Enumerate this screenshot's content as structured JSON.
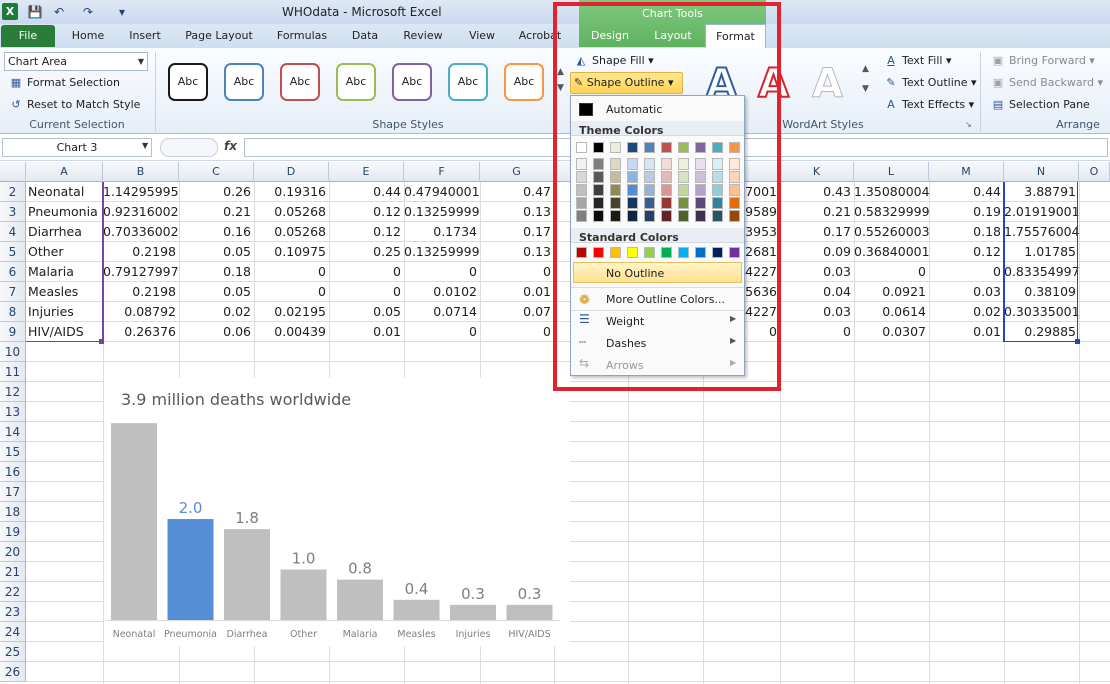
{
  "app": {
    "window_title": "WHOdata  -  Microsoft Excel",
    "context_tab": "Chart Tools"
  },
  "tabs": [
    "File",
    "Home",
    "Insert",
    "Page Layout",
    "Formulas",
    "Data",
    "Review",
    "View",
    "Acrobat",
    "Design",
    "Layout",
    "Format"
  ],
  "ribbon": {
    "current_selection": {
      "combo": "Chart Area",
      "format_selection": "Format Selection",
      "reset": "Reset to Match Style",
      "label": "Current Selection"
    },
    "shape_styles": {
      "samples": [
        "Abc",
        "Abc",
        "Abc",
        "Abc",
        "Abc",
        "Abc",
        "Abc"
      ],
      "label": "Shape Styles",
      "colors": [
        "#1a1a1a",
        "#4f81bd",
        "#c0504d",
        "#9bbb59",
        "#8064a2",
        "#4bacc6",
        "#f79646"
      ]
    },
    "shape_fill": "Shape Fill",
    "shape_outline": "Shape Outline",
    "wordart": {
      "label": "WordArt Styles",
      "text_fill": "Text Fill",
      "text_outline": "Text Outline",
      "text_effects": "Text Effects"
    },
    "arrange": {
      "label": "Arrange",
      "bring_forward": "Bring Forward",
      "send_backward": "Send Backward",
      "selection_pane": "Selection Pane"
    }
  },
  "formula_bar": {
    "name_box": "Chart 3",
    "fx": "fx",
    "value": ""
  },
  "columns": [
    "A",
    "B",
    "C",
    "D",
    "E",
    "F",
    "G",
    "K",
    "L",
    "M",
    "N"
  ],
  "rows": [
    "2",
    "3",
    "4",
    "5",
    "6",
    "7",
    "8",
    "9",
    "10",
    "11",
    "12",
    "13",
    "14",
    "15",
    "16",
    "17",
    "18",
    "19",
    "20",
    "21",
    "22",
    "23",
    "24",
    "25",
    "26"
  ],
  "table": [
    {
      "a": "Neonatal",
      "b": "1.14295995",
      "c": "0.26",
      "d": "0.19316",
      "e": "0.44",
      "f": "0.47940001",
      "g": "0.47",
      "j": "37001",
      "k": "0.43",
      "l": "1.35080004",
      "m": "0.44",
      "n": "3.88791"
    },
    {
      "a": "Pneumonia",
      "b": "0.92316002",
      "c": "0.21",
      "d": "0.05268",
      "e": "0.12",
      "f": "0.13259999",
      "g": "0.13",
      "j": "29589",
      "k": "0.21",
      "l": "0.58329999",
      "m": "0.19",
      "n": "2.01919001"
    },
    {
      "a": "Diarrhea",
      "b": "0.70336002",
      "c": "0.16",
      "d": "0.05268",
      "e": "0.12",
      "f": "0.1734",
      "g": "0.17",
      "j": "23953",
      "k": "0.17",
      "l": "0.55260003",
      "m": "0.18",
      "n": "1.75576004"
    },
    {
      "a": "Other",
      "b": "0.2198",
      "c": "0.05",
      "d": "0.10975",
      "e": "0.25",
      "f": "0.13259999",
      "g": "0.13",
      "j": "12681",
      "k": "0.09",
      "l": "0.36840001",
      "m": "0.12",
      "n": "1.01785"
    },
    {
      "a": "Malaria",
      "b": "0.79127997",
      "c": "0.18",
      "d": "0",
      "e": "0",
      "f": "0",
      "g": "0",
      "j": "04227",
      "k": "0.03",
      "l": "0",
      "m": "0",
      "n": "0.83354997"
    },
    {
      "a": "Measles",
      "b": "0.2198",
      "c": "0.05",
      "d": "0",
      "e": "0",
      "f": "0.0102",
      "g": "0.01",
      "j": "05636",
      "k": "0.04",
      "l": "0.0921",
      "m": "0.03",
      "n": "0.38109"
    },
    {
      "a": "Injuries",
      "b": "0.08792",
      "c": "0.02",
      "d": "0.02195",
      "e": "0.05",
      "f": "0.0714",
      "g": "0.07",
      "j": "04227",
      "k": "0.03",
      "l": "0.0614",
      "m": "0.02",
      "n": "0.30335001"
    },
    {
      "a": "HIV/AIDS",
      "b": "0.26376",
      "c": "0.06",
      "d": "0.00439",
      "e": "0.01",
      "f": "0",
      "g": "0",
      "j": "0",
      "k": "0",
      "l": "0.0307",
      "m": "0.01",
      "n": "0.29885"
    }
  ],
  "dropdown": {
    "automatic": "Automatic",
    "theme_colors": "Theme Colors",
    "standard_colors": "Standard Colors",
    "no_outline": "No Outline",
    "more_colors": "More Outline Colors...",
    "weight": "Weight",
    "dashes": "Dashes",
    "arrows": "Arrows",
    "theme_row": [
      "#ffffff",
      "#000000",
      "#eeece1",
      "#1f497d",
      "#4f81bd",
      "#c0504d",
      "#9bbb59",
      "#8064a2",
      "#4bacc6",
      "#f79646"
    ],
    "theme_shades": [
      [
        "#f2f2f2",
        "#7f7f7f",
        "#ddd9c3",
        "#c6d9f0",
        "#dbe5f1",
        "#f2dcdb",
        "#ebf1dd",
        "#e5e0ec",
        "#dbeef3",
        "#fdeada"
      ],
      [
        "#d8d8d8",
        "#595959",
        "#c4bd97",
        "#8db3e2",
        "#b8cce4",
        "#e5b9b7",
        "#d7e3bc",
        "#ccc1d9",
        "#b7dde8",
        "#fbd5b5"
      ],
      [
        "#bfbfbf",
        "#3f3f3f",
        "#938953",
        "#548dd4",
        "#95b3d7",
        "#d99694",
        "#c3d69b",
        "#b2a2c7",
        "#92cddc",
        "#fac08f"
      ],
      [
        "#a5a5a5",
        "#262626",
        "#494429",
        "#17365d",
        "#366092",
        "#953734",
        "#76923c",
        "#5f497a",
        "#31859b",
        "#e36c09"
      ],
      [
        "#7f7f7f",
        "#0c0c0c",
        "#1d1b10",
        "#0f243e",
        "#244061",
        "#632423",
        "#4f6128",
        "#3f3151",
        "#205867",
        "#974806"
      ]
    ],
    "standard_row": [
      "#c00000",
      "#ff0000",
      "#ffc000",
      "#ffff00",
      "#92d050",
      "#00b050",
      "#00b0f0",
      "#0070c0",
      "#002060",
      "#7030a0"
    ]
  },
  "chart_data": {
    "type": "bar",
    "title": "3.9  million deaths worldwide",
    "categories": [
      "Neonatal",
      "Pneumonia",
      "Diarrhea",
      "Other",
      "Malaria",
      "Measles",
      "Injuries",
      "HIV/AIDS"
    ],
    "values": [
      3.9,
      2.0,
      1.8,
      1.0,
      0.8,
      0.4,
      0.3,
      0.3
    ],
    "data_labels": [
      "",
      "2.0",
      "1.8",
      "1.0",
      "0.8",
      "0.4",
      "0.3",
      "0.3"
    ],
    "colors": {
      "default": "#bfbfbf",
      "highlight": "#558ed5",
      "label": "#7f7f7f",
      "highlight_label": "#558ed5"
    },
    "highlight_index": 1,
    "ylim": [
      0,
      4.2
    ]
  }
}
